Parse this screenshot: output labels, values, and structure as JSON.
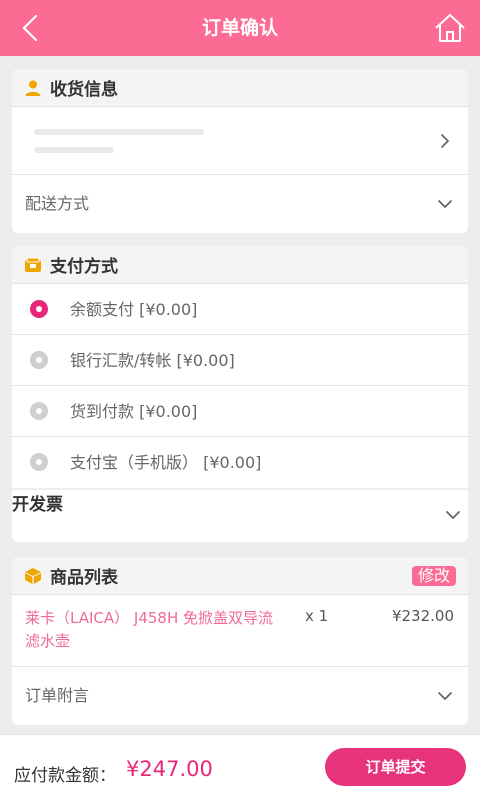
{
  "header": {
    "title": "订单确认",
    "back_icon": "chevron-left-icon",
    "home_icon": "home-icon",
    "bg_color": "#fb6b93"
  },
  "shipping": {
    "title": "收货信息",
    "icon": "user-icon",
    "delivery_label": "配送方式"
  },
  "payment": {
    "title": "支付方式",
    "icon": "wallet-icon",
    "options": [
      {
        "label": "余额支付 [¥0.00]",
        "selected": true
      },
      {
        "label": "银行汇款/转帐 [¥0.00]",
        "selected": false
      },
      {
        "label": "货到付款 [¥0.00]",
        "selected": false
      },
      {
        "label": "支付宝（手机版） [¥0.00]",
        "selected": false
      }
    ]
  },
  "invoice": {
    "label": "开发票"
  },
  "products": {
    "title": "商品列表",
    "icon": "package-icon",
    "edit_label": "修改",
    "items": [
      {
        "name": "莱卡（LAICA） J458H 免掀盖双导流 滤水壶",
        "qty": "x 1",
        "price": "¥232.00"
      }
    ],
    "note_label": "订单附言"
  },
  "footer": {
    "amount_label": "应付款金额：",
    "amount": "¥247.00",
    "submit_label": "订单提交",
    "accent_color": "#e8277a"
  }
}
